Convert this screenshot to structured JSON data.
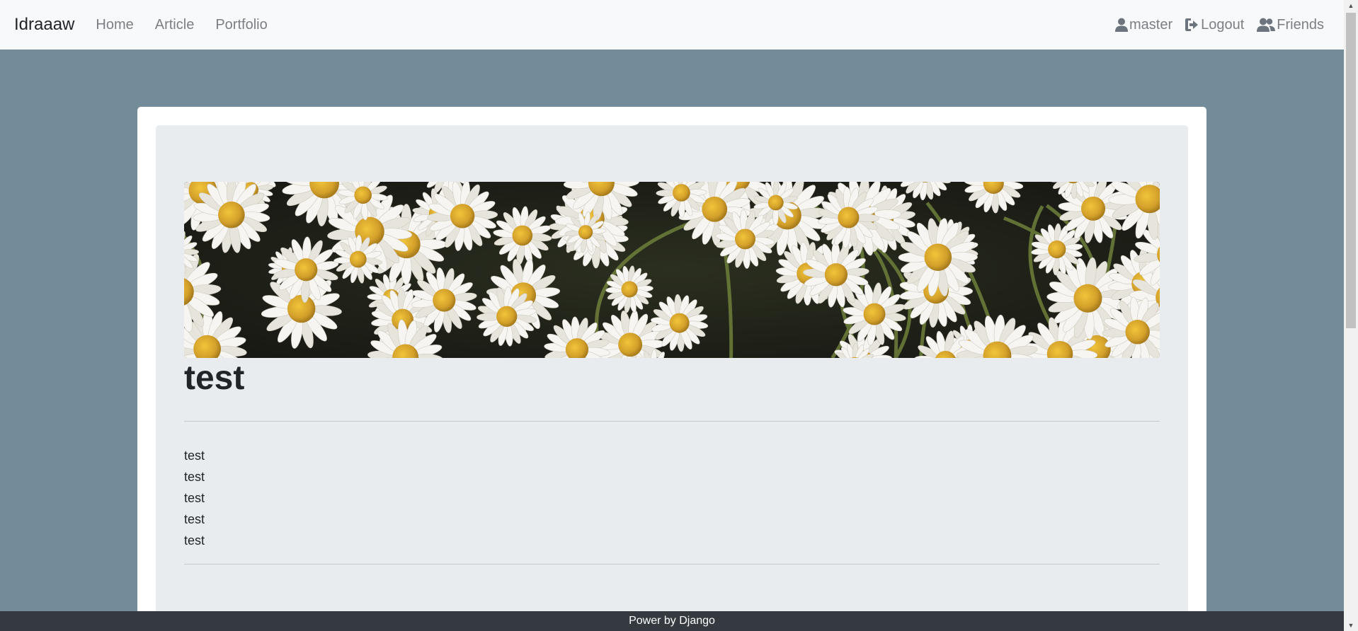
{
  "navbar": {
    "brand": "Idraaaw",
    "links": [
      "Home",
      "Article",
      "Portfolio"
    ],
    "right": [
      {
        "icon": "user-icon",
        "label": "master"
      },
      {
        "icon": "logout-icon",
        "label": "Logout"
      },
      {
        "icon": "users-icon",
        "label": "Friends"
      }
    ]
  },
  "article": {
    "title": "test",
    "lines": [
      "test",
      "test",
      "test",
      "test",
      "test"
    ]
  },
  "footer": {
    "text": "Power by Django"
  },
  "colors": {
    "page_bg": "#748b99",
    "navbar_bg": "#f8f9fa",
    "jumbotron_bg": "#e9ecef",
    "footer_bg": "#343a40"
  }
}
